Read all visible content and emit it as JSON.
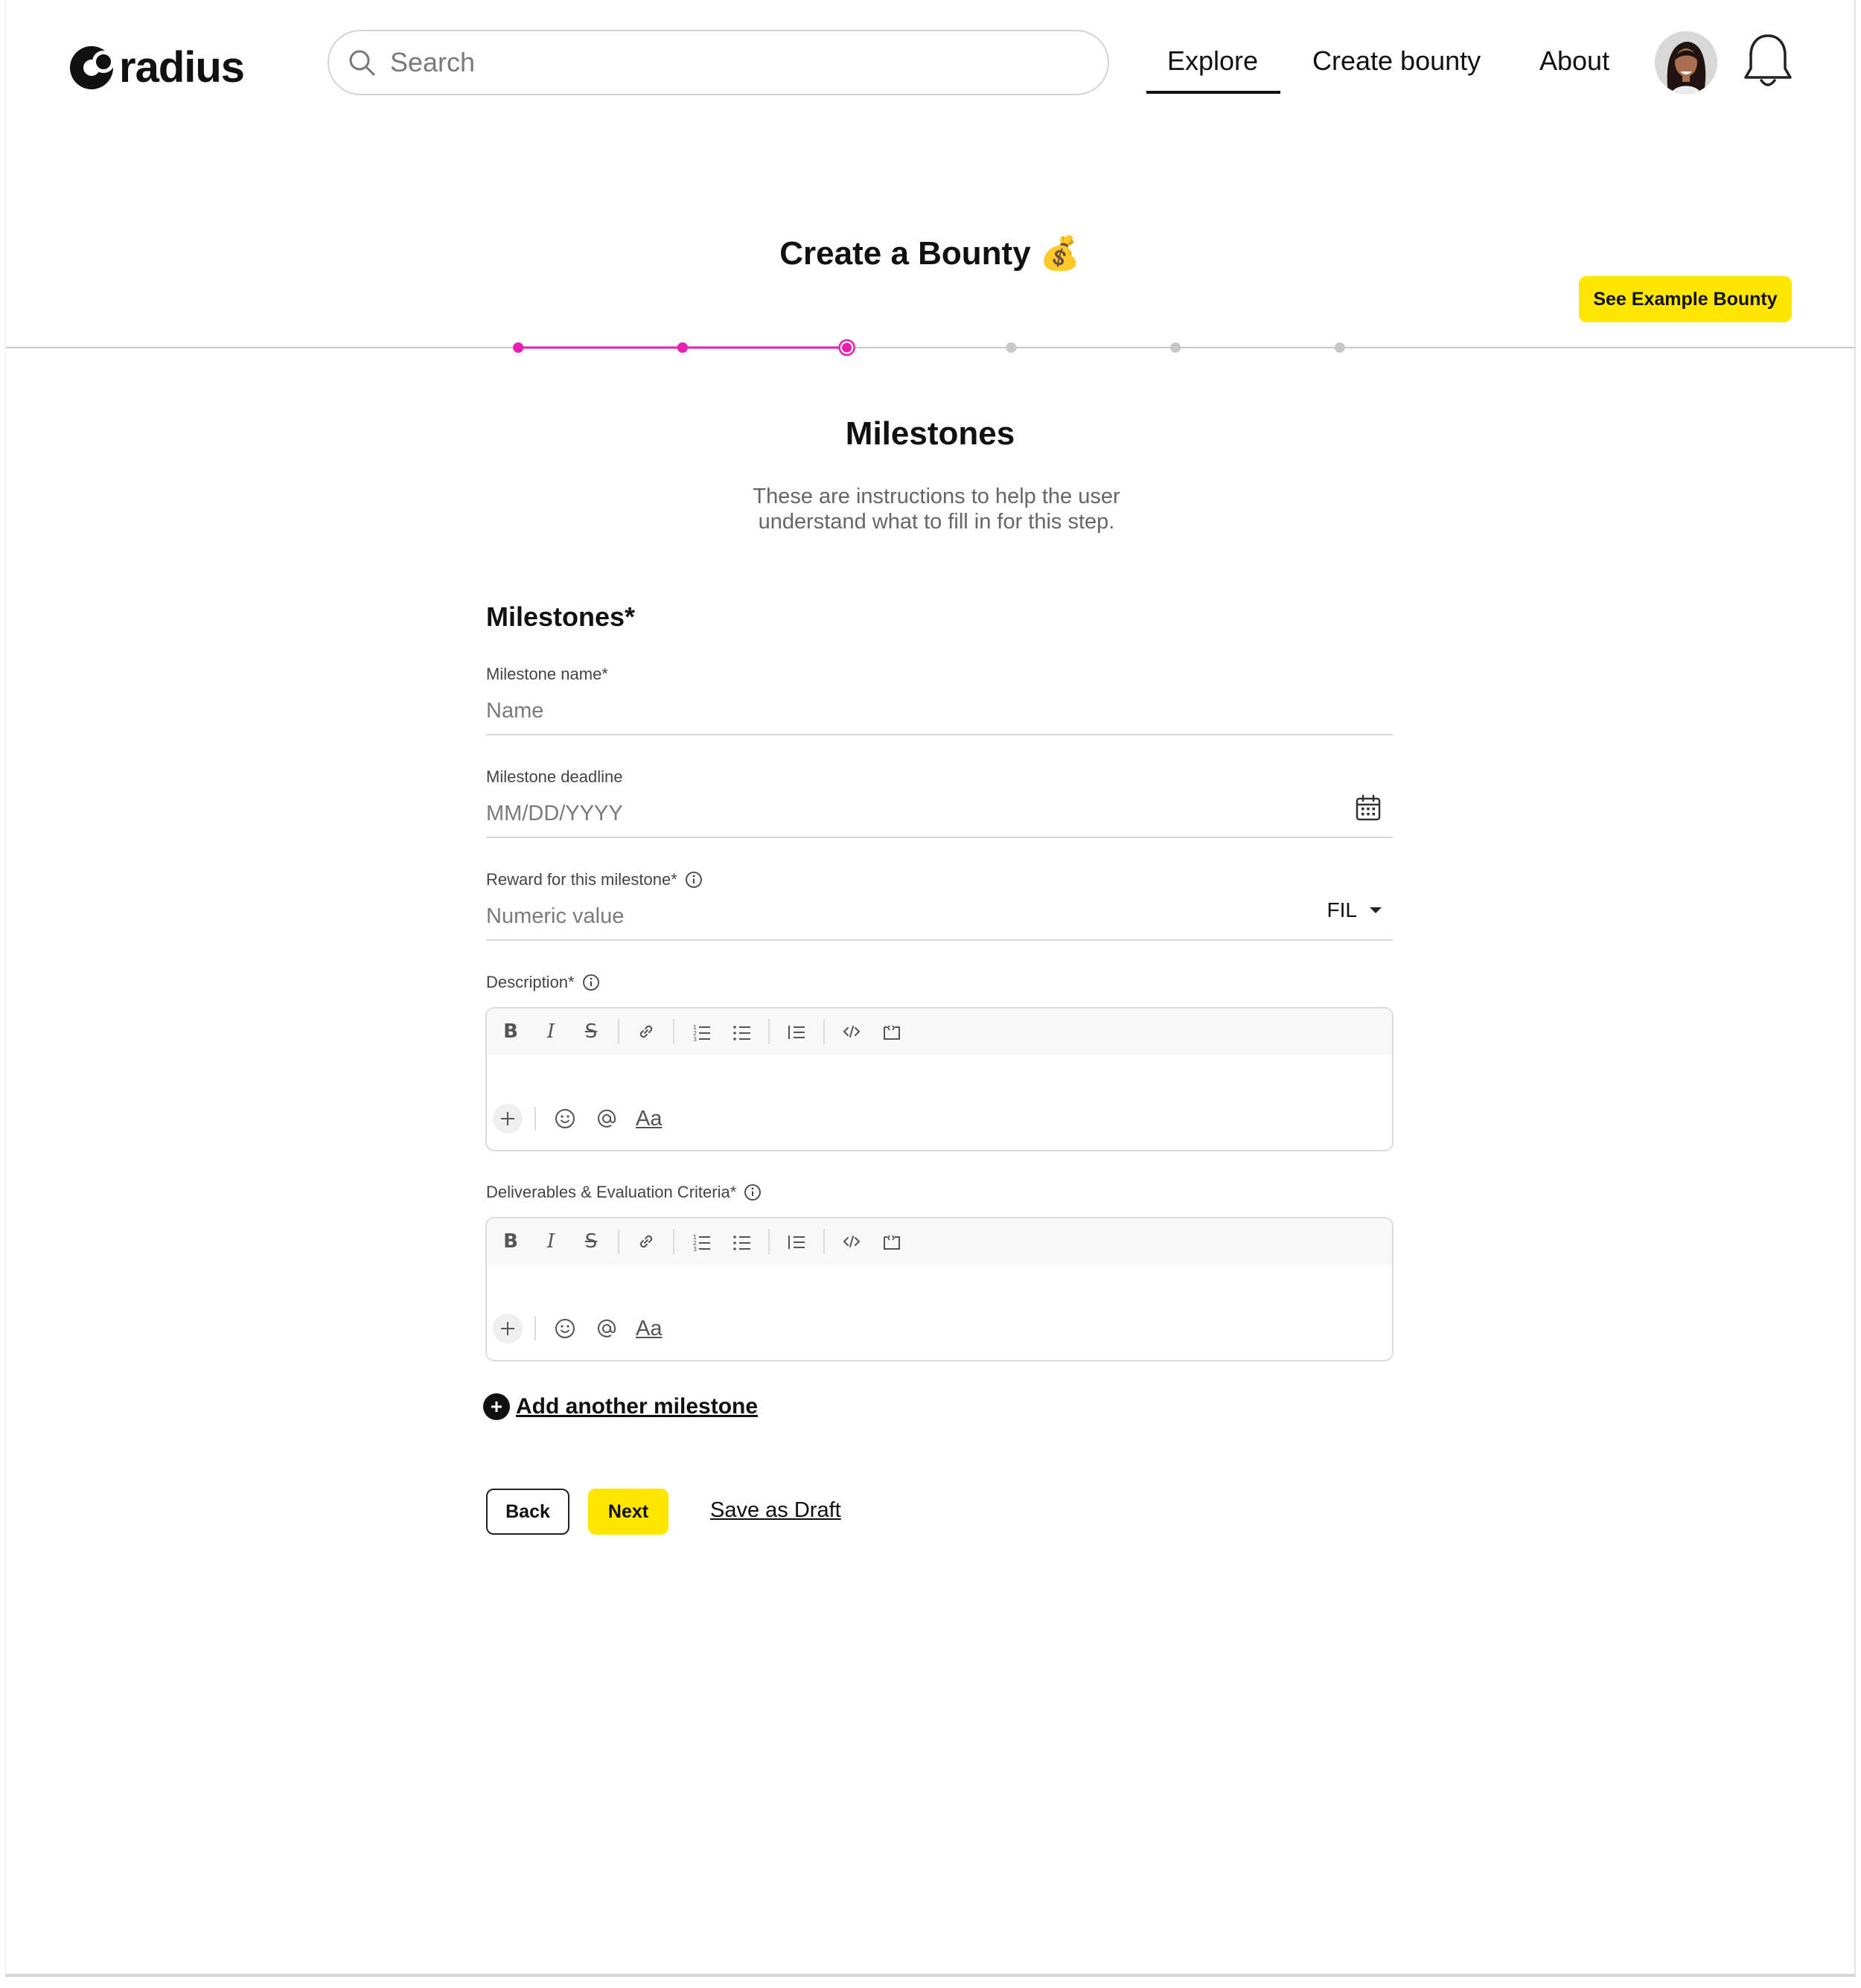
{
  "header": {
    "logo_text": "radius",
    "search_placeholder": "Search",
    "nav": {
      "explore": "Explore",
      "create_bounty": "Create bounty",
      "about": "About"
    },
    "active_nav": "Explore"
  },
  "page": {
    "title": "Create a Bounty",
    "title_emoji": "💰",
    "example_button": "See Example Bounty"
  },
  "stepper": {
    "total_steps": 6,
    "current_step": 3,
    "accent_color": "#e91eb0",
    "inactive_color": "#c8c8c8"
  },
  "section": {
    "title": "Milestones",
    "instructions": "These are instructions to help the user understand what to fill in for this step."
  },
  "form": {
    "heading": "Milestones*",
    "milestone_name": {
      "label": "Milestone name*",
      "placeholder": "Name"
    },
    "milestone_deadline": {
      "label": "Milestone deadline",
      "placeholder": "MM/DD/YYYY"
    },
    "reward": {
      "label": "Reward for this milestone*",
      "placeholder": "Numeric value",
      "currency": "FIL"
    },
    "description": {
      "label": "Description*"
    },
    "deliverables": {
      "label": "Deliverables & Evaluation Criteria*"
    },
    "editor_font_label": "Aa",
    "add_milestone": "Add another milestone"
  },
  "actions": {
    "back": "Back",
    "next": "Next",
    "save_draft": "Save as Draft"
  },
  "colors": {
    "accent_yellow": "#ffe600",
    "stepper_pink": "#e91eb0",
    "text": "#111111"
  }
}
